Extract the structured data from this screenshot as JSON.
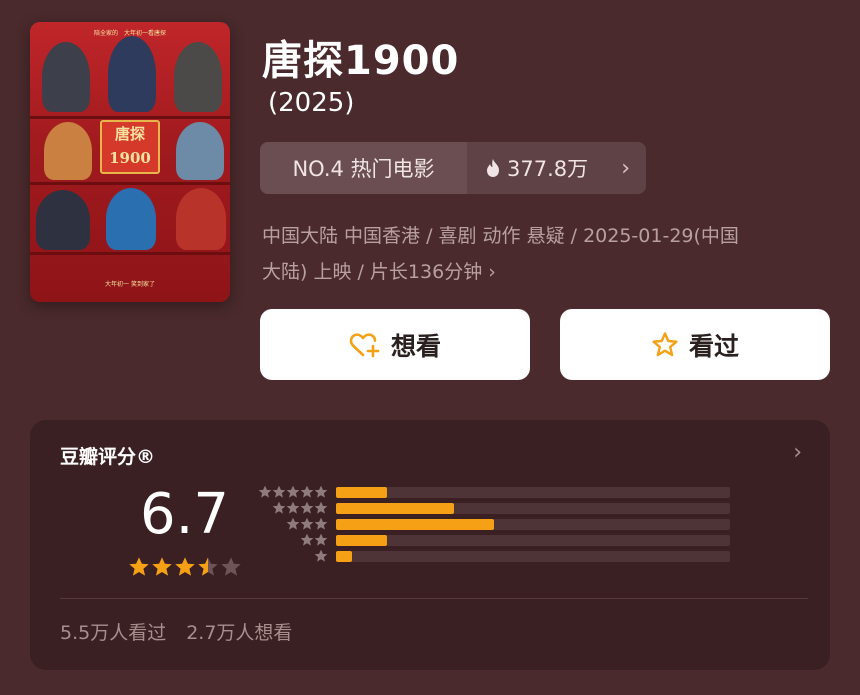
{
  "movie": {
    "title": "唐探1900",
    "year": "(2025)",
    "poster": {
      "title_text": "唐探 1900",
      "tagline_top": "陪全家的　大年初一看唐探",
      "tagline_bottom": "大年初一 笑到家了"
    },
    "rank": "NO.4 热门电影",
    "heat": "377.8万",
    "meta_line1": "中国大陆 中国香港 / 喜剧 动作 悬疑 / 2025-01-29(中国",
    "meta_line2": "大陆) 上映 / 片长136分钟"
  },
  "actions": {
    "want_label": "想看",
    "seen_label": "看过"
  },
  "rating": {
    "label": "豆瓣评分®",
    "score": "6.7",
    "stars_filled": 3.5,
    "distribution": [
      {
        "stars": 5,
        "fraction": 0.13
      },
      {
        "stars": 4,
        "fraction": 0.3
      },
      {
        "stars": 3,
        "fraction": 0.4
      },
      {
        "stars": 2,
        "fraction": 0.13
      },
      {
        "stars": 1,
        "fraction": 0.04
      }
    ],
    "seen_count": "5.5万人看过",
    "want_count": "2.7万人想看"
  },
  "colors": {
    "background": "#4a2a2c",
    "card": "#3a2022",
    "accent": "#f5a015"
  }
}
